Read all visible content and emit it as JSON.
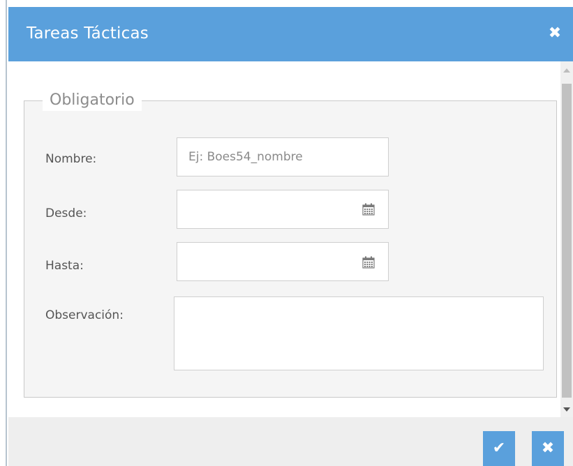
{
  "dialog": {
    "title": "Tareas Tácticas",
    "close_icon": "close-icon"
  },
  "fieldset": {
    "legend": "Obligatorio"
  },
  "form": {
    "nombre": {
      "label": "Nombre:",
      "value": "",
      "placeholder": "Ej: Boes54_nombre"
    },
    "desde": {
      "label": "Desde:",
      "value": "",
      "icon": "calendar-icon"
    },
    "hasta": {
      "label": "Hasta:",
      "value": "",
      "icon": "calendar-icon"
    },
    "observacion": {
      "label": "Observación:",
      "value": ""
    }
  },
  "footer": {
    "confirm_icon": "check-icon",
    "cancel_icon": "close-icon"
  },
  "colors": {
    "accent": "#5aa0dc",
    "fieldset_bg": "#f5f5f5",
    "footer_bg": "#eeeeee"
  }
}
